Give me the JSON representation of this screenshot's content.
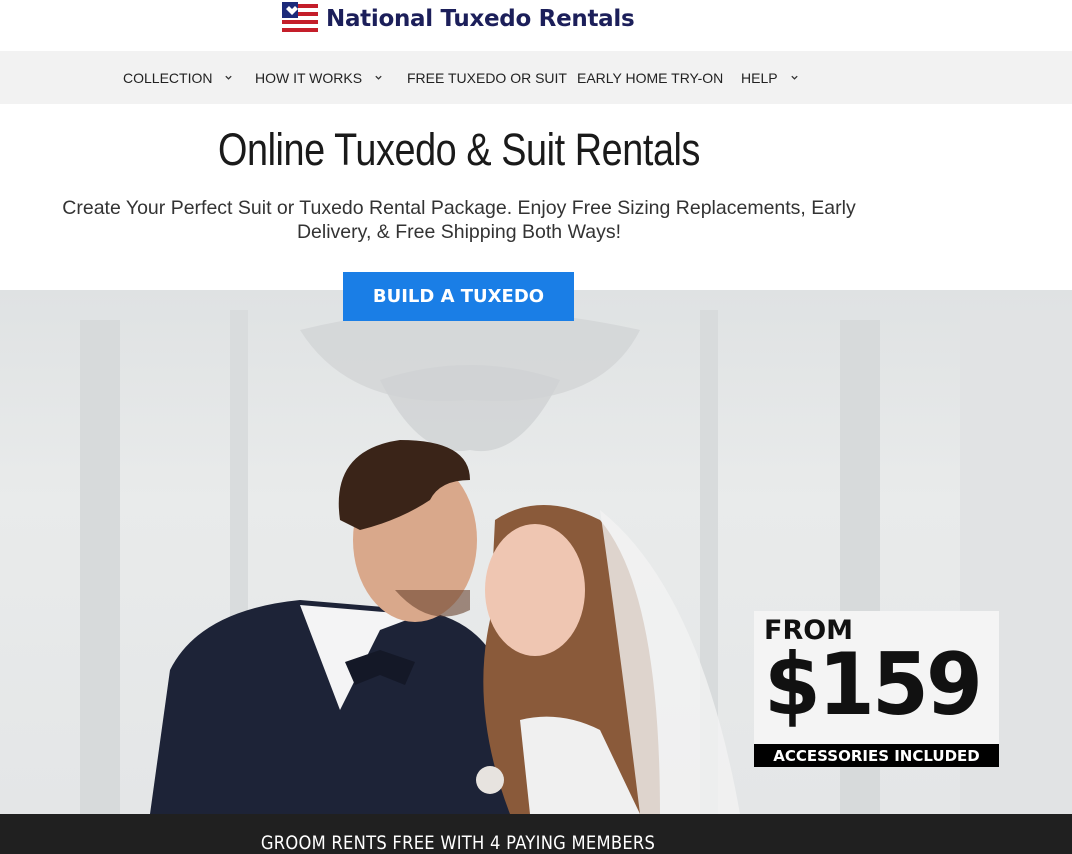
{
  "brand": {
    "name": "National Tuxedo Rentals"
  },
  "nav": {
    "items": [
      {
        "label": "COLLECTION",
        "has_dropdown": true
      },
      {
        "label": "HOW IT WORKS",
        "has_dropdown": true
      },
      {
        "label": "FREE TUXEDO OR SUIT",
        "has_dropdown": false
      },
      {
        "label": "EARLY HOME TRY-ON",
        "has_dropdown": false
      },
      {
        "label": "HELP",
        "has_dropdown": true
      }
    ]
  },
  "hero": {
    "title": "Online Tuxedo & Suit Rentals",
    "subtitle": "Create Your Perfect Suit or Tuxedo Rental Package. Enjoy Free Sizing Replacements, Early Delivery, & Free Shipping Both Ways!",
    "cta_label": "BUILD A TUXEDO",
    "image_alt": "groom-and-bride-photo"
  },
  "price_badge": {
    "prefix": "FROM",
    "amount": "$159",
    "note": "ACCESSORIES INCLUDED"
  },
  "promo_bar": {
    "text": "GROOM RENTS FREE WITH 4 PAYING MEMBERS"
  },
  "colors": {
    "brand_navy": "#1c1f5a",
    "cta_blue": "#1a7ee6",
    "promo_bg": "#202020",
    "nav_bg": "#f2f2f2"
  }
}
